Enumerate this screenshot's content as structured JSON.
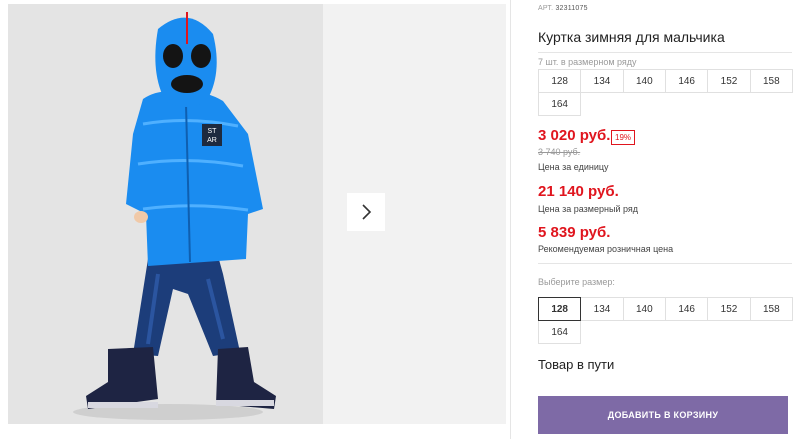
{
  "product": {
    "sku_label": "АРТ.",
    "sku_value": "32311075",
    "title": "Куртка зимняя для мальчика"
  },
  "size_row": {
    "caption": "7 шт. в размерном ряду",
    "sizes": [
      "128",
      "134",
      "140",
      "146",
      "152",
      "158",
      "164"
    ]
  },
  "price": {
    "current": "3 020 руб.",
    "discount_badge": "19%",
    "old": "3 740 руб.",
    "unit_note": "Цена за единицу",
    "row_price": "21 140 руб.",
    "row_note": "Цена за размерный ряд",
    "retail_price": "5 839 руб.",
    "retail_note": "Рекомендуемая розничная цена"
  },
  "size_picker": {
    "caption": "Выберите размер:",
    "sizes": [
      "128",
      "134",
      "140",
      "146",
      "152",
      "158",
      "164"
    ],
    "selected": "128"
  },
  "status": "Товар в пути",
  "cart_button": "ДОБАВИТЬ В КОРЗИНУ",
  "photo_print": [
    "ST",
    "AR"
  ],
  "colors": {
    "accent_red": "#e0151e",
    "cart_purple": "#7e6aa6",
    "jacket_blue": "#1a8cf0"
  },
  "icons": {
    "next": "chevron-right-icon"
  }
}
